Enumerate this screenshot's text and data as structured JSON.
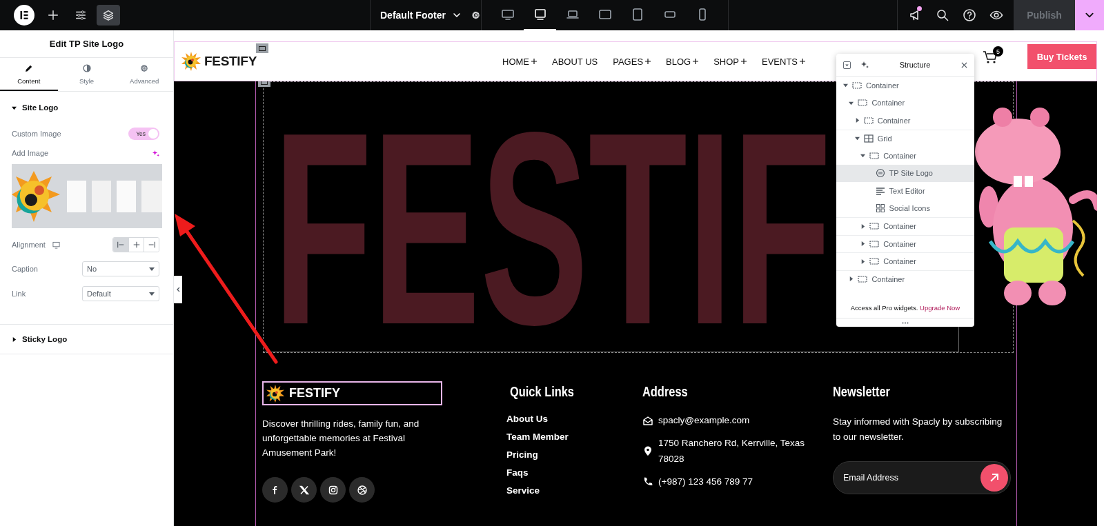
{
  "editor_toolbar": {
    "tools": [
      {
        "kind": "add",
        "selected": false
      },
      {
        "kind": "settings",
        "selected": false
      },
      {
        "kind": "structure",
        "selected": true
      }
    ],
    "document_title": "Default Footer",
    "devices": [
      {
        "kind": "widescreen",
        "selected": false
      },
      {
        "kind": "desktop",
        "selected": true
      },
      {
        "kind": "laptop",
        "selected": false
      },
      {
        "kind": "tabletwide",
        "selected": false
      },
      {
        "kind": "tablet",
        "selected": false
      },
      {
        "kind": "mobilewide",
        "selected": false
      },
      {
        "kind": "mobile",
        "selected": false
      }
    ],
    "notifications_unread": true,
    "publish": {
      "label": "Publish",
      "disabled": true
    }
  },
  "panel": {
    "title": "Edit TP Site Logo",
    "tabs": [
      {
        "label": "Content",
        "kind": "content",
        "selected": true
      },
      {
        "label": "Style",
        "kind": "style",
        "selected": false
      },
      {
        "label": "Advanced",
        "kind": "advanced",
        "selected": false
      }
    ],
    "sections": [
      {
        "title": "Site Logo",
        "expanded": true,
        "controls": [
          {
            "kind": "toggle",
            "label": "Custom Image",
            "on": true,
            "state_label": "Yes"
          },
          {
            "kind": "media",
            "label": "Add Image"
          },
          {
            "kind": "alignment",
            "label": "Alignment",
            "options": [
              {
                "kind": "start",
                "selected": true
              },
              {
                "kind": "center",
                "selected": false
              },
              {
                "kind": "end",
                "selected": false
              }
            ]
          },
          {
            "kind": "select",
            "label": "Caption",
            "value": "No"
          },
          {
            "kind": "select",
            "label": "Link",
            "value": "Default"
          }
        ]
      },
      {
        "title": "Sticky Logo",
        "expanded": false
      }
    ]
  },
  "site_header": {
    "logo_text": "FESTIFY",
    "nav": [
      {
        "label": "HOME",
        "submenu": true
      },
      {
        "label": "ABOUT US",
        "submenu": false
      },
      {
        "label": "PAGES",
        "submenu": true
      },
      {
        "label": "BLOG",
        "submenu": true
      },
      {
        "label": "SHOP",
        "submenu": true
      },
      {
        "label": "EVENTS",
        "submenu": true
      }
    ],
    "cart_count": "5",
    "cta": "Buy Tickets"
  },
  "hero": {
    "big_text": "FESTIF"
  },
  "structure": {
    "title": "Structure",
    "tree": [
      {
        "label": "Container",
        "kind": "container",
        "expanded": true,
        "selected": false,
        "children": [
          {
            "label": "Container",
            "kind": "container",
            "expanded": true,
            "selected": false,
            "children": [
              {
                "label": "Container",
                "kind": "container",
                "expanded": false,
                "selected": false
              },
              {
                "label": "Grid",
                "kind": "grid",
                "expanded": true,
                "selected": false,
                "children": [
                  {
                    "label": "Container",
                    "kind": "container",
                    "expanded": true,
                    "selected": false,
                    "children": [
                      {
                        "label": "TP Site Logo",
                        "kind": "logo",
                        "selected": true
                      },
                      {
                        "label": "Text Editor",
                        "kind": "text",
                        "selected": false
                      },
                      {
                        "label": "Social Icons",
                        "kind": "social",
                        "selected": false
                      }
                    ]
                  },
                  {
                    "label": "Container",
                    "kind": "container",
                    "expanded": false,
                    "selected": false
                  },
                  {
                    "label": "Container",
                    "kind": "container",
                    "expanded": false,
                    "selected": false
                  },
                  {
                    "label": "Container",
                    "kind": "container",
                    "expanded": false,
                    "selected": false
                  }
                ]
              }
            ]
          },
          {
            "label": "Container",
            "kind": "container",
            "expanded": false,
            "selected": false
          }
        ]
      }
    ],
    "promo_text": "Access all Pro widgets.",
    "promo_link": "Upgrade Now"
  },
  "footer": {
    "logo_text": "FESTIFY",
    "description": "Discover thrilling rides, family fun, and unforgettable memories at Festival Amusement Park!",
    "socials": [
      {
        "kind": "facebook"
      },
      {
        "kind": "x"
      },
      {
        "kind": "instagram"
      },
      {
        "kind": "dribbble"
      }
    ],
    "quick_links": {
      "heading": "Quick Links",
      "links": [
        "About Us",
        "Team Member",
        "Pricing",
        "Faqs",
        "Service"
      ]
    },
    "address": {
      "heading": "Address",
      "items": [
        {
          "kind": "email",
          "text": "spacly@example.com"
        },
        {
          "kind": "location",
          "text": "1750 Ranchero Rd, Kerrville, Texas 78028"
        },
        {
          "kind": "phone",
          "text": "(+987) 123 456 789 77"
        }
      ]
    },
    "newsletter": {
      "heading": "Newsletter",
      "text": "Stay informed with Spacly by subscribing to our newsletter.",
      "placeholder": "Email Address"
    }
  }
}
